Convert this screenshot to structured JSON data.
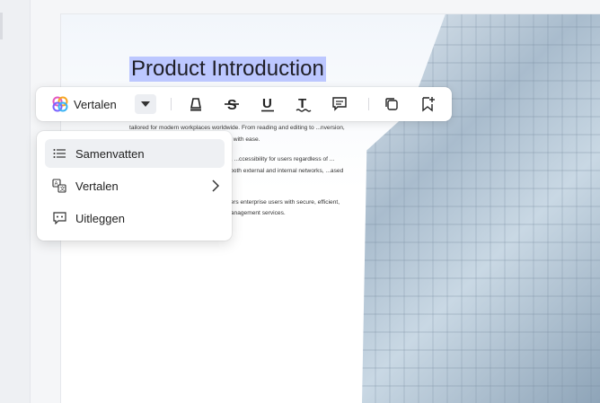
{
  "document": {
    "title": "Product Introduction",
    "paragraphs": [
      "tailored for modern workplaces worldwide. From reading and editing to ...nversion, form filling, signing and ...gement tasks with ease.",
      "...ns, including Windows, Mac, Android, ...ccessibility for users regardless of ... UPDF caters to enterprise needs by ...both external and internal networks, ...ased authentication management.",
      "...tive, top-tier solutions, UPDF empowers enterprise users with secure, efficient, and intelligent PDF digital document management services."
    ]
  },
  "toolbar": {
    "translate_label": "Vertalen",
    "icons": [
      "highlighter-icon",
      "strikethrough-icon",
      "underline-icon",
      "squiggly-text-icon",
      "comment-icon",
      "copy-icon",
      "add-bookmark-icon"
    ]
  },
  "menu": {
    "items": [
      {
        "label": "Samenvatten",
        "icon": "list-icon"
      },
      {
        "label": "Vertalen",
        "icon": "translate-icon"
      },
      {
        "label": "Uitleggen",
        "icon": "explain-icon"
      }
    ]
  },
  "colors": {
    "selection": "#bcc7ff",
    "menu_hover": "#eef0f3"
  }
}
